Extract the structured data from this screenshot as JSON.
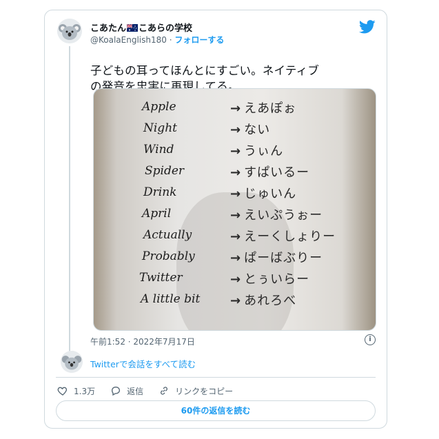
{
  "author": {
    "name_before_flag": "こあたん",
    "name_after_flag": "こあらの学校",
    "handle": "@KoalaEnglish180",
    "separator": "·",
    "follow_label": "フォローする"
  },
  "tweet": {
    "text_line1": "子どもの耳ってほんとにすごい。ネイティブ",
    "text_line2": "の発音を忠実に再現してる。"
  },
  "photo": {
    "rows": [
      {
        "en": "Apple",
        "jp": "えあぽぉ"
      },
      {
        "en": "Night",
        "jp": "ない"
      },
      {
        "en": "Wind",
        "jp": "うぃん"
      },
      {
        "en": "Spider",
        "jp": "すぱいるー"
      },
      {
        "en": "Drink",
        "jp": "じゅいん"
      },
      {
        "en": "April",
        "jp": "えいぷうぉー"
      },
      {
        "en": "Actually",
        "jp": "えーくしょりー"
      },
      {
        "en": "Probably",
        "jp": "ぱーばぶりー"
      },
      {
        "en": "Twitter",
        "jp": "とぅいらー"
      },
      {
        "en": "A little bit",
        "jp": "あれろべ"
      }
    ],
    "arrow": "→"
  },
  "meta": {
    "timestamp": "午前1:52 · 2022年7月17日",
    "info_icon_glyph": "i"
  },
  "conversation": {
    "read_label": "Twitterで会話をすべて読む"
  },
  "actions": {
    "like_count": "1.3万",
    "reply_label": "返信",
    "copy_link_label": "リンクをコピー"
  },
  "replies_button": {
    "label": "60件の返信を読む"
  },
  "colors": {
    "accent": "#1d9bf0",
    "secondary_text": "#536471",
    "border": "#cfd9de"
  }
}
